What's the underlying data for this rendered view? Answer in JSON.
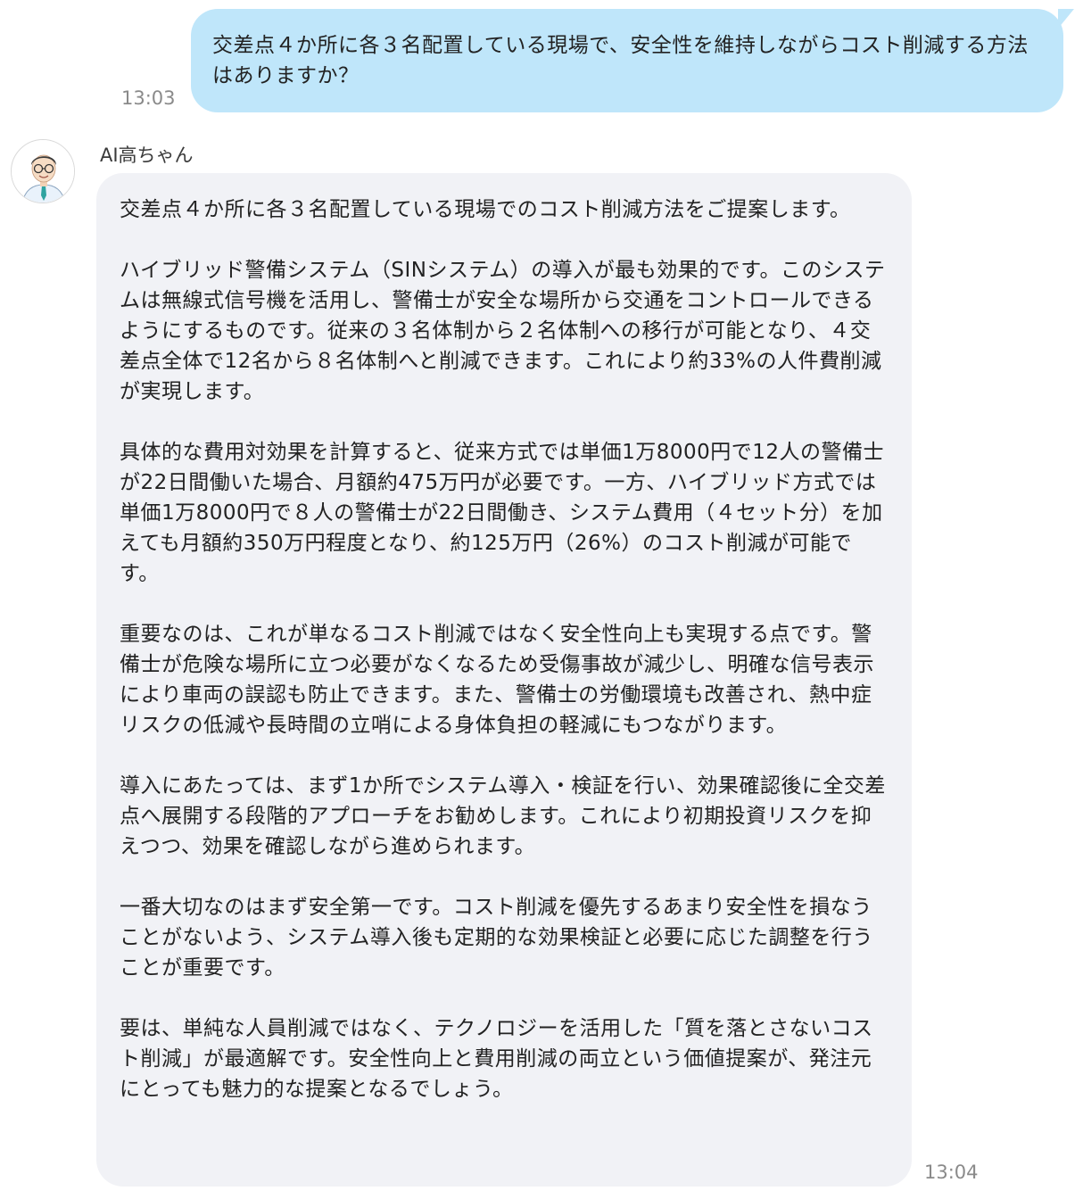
{
  "user_message": {
    "text": "交差点４か所に各３名配置している現場で、安全性を維持しながらコスト削減する方法はありますか？",
    "time": "13:03"
  },
  "bot_message": {
    "sender_name": "AI高ちゃん",
    "avatar_icon": "person-with-glasses-avatar",
    "paragraphs": [
      "交差点４か所に各３名配置している現場でのコスト削減方法をご提案します。",
      "ハイブリッド警備システム（SINシステム）の導入が最も効果的です。このシステムは無線式信号機を活用し、警備士が安全な場所から交通をコントロールできるようにするものです。従来の３名体制から２名体制への移行が可能となり、４交差点全体で12名から８名体制へと削減できます。これにより約33%の人件費削減が実現します。",
      "具体的な費用対効果を計算すると、従来方式では単価1万8000円で12人の警備士が22日間働いた場合、月額約475万円が必要です。一方、ハイブリッド方式では単価1万8000円で８人の警備士が22日間働き、システム費用（４セット分）を加えても月額約350万円程度となり、約125万円（26%）のコスト削減が可能です。",
      "重要なのは、これが単なるコスト削減ではなく安全性向上も実現する点です。警備士が危険な場所に立つ必要がなくなるため受傷事故が減少し、明確な信号表示により車両の誤認も防止できます。また、警備士の労働環境も改善され、熱中症リスクの低減や長時間の立哨による身体負担の軽減にもつながります。",
      "導入にあたっては、まず1か所でシステム導入・検証を行い、効果確認後に全交差点へ展開する段階的アプローチをお勧めします。これにより初期投資リスクを抑えつつ、効果を確認しながら進められます。",
      "一番大切なのはまず安全第一です。コスト削減を優先するあまり安全性を損なうことがないよう、システム導入後も定期的な効果検証と必要に応じた調整を行うことが重要です。",
      "要は、単純な人員削減ではなく、テクノロジーを活用した「質を落とさないコスト削減」が最適解です。安全性向上と費用削減の両立という価値提案が、発注元にとっても魅力的な提案となるでしょう。"
    ],
    "time": "13:04"
  },
  "colors": {
    "user_bubble": "#bfe6fa",
    "bot_bubble": "#f1f2f6",
    "timestamp": "#8a8a8a"
  }
}
